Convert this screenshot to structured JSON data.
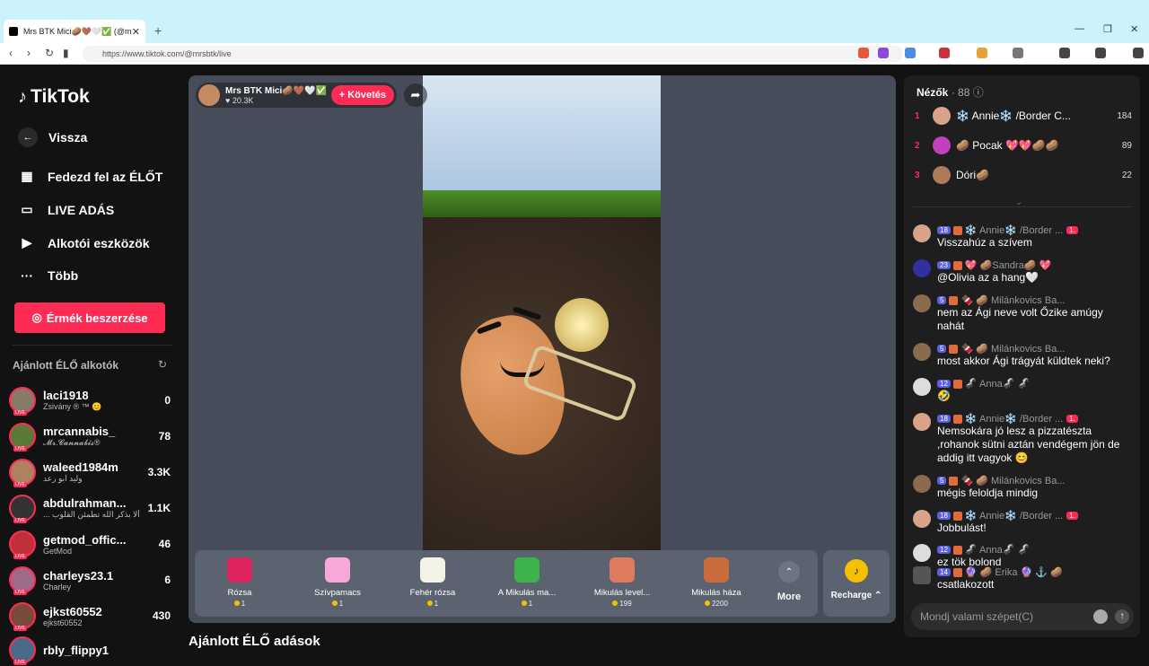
{
  "browser": {
    "tab_title": "Mrs BTK Mici🥔🤎🤍✅ (@m",
    "url": "https://www.tiktok.com/@mrsbtk/live"
  },
  "sidebar": {
    "logo": "TikTok",
    "back": "Vissza",
    "items": [
      {
        "label": "Fedezd fel az ÉLŐT",
        "icon": "calendar-icon"
      },
      {
        "label": "LIVE ADÁS",
        "icon": "camera-icon"
      },
      {
        "label": "Alkotói eszközök",
        "icon": "play-square-icon"
      },
      {
        "label": "Több",
        "icon": "more-dots-icon"
      }
    ],
    "coins_button": "Érmék beszerzése",
    "recommended_title": "Ajánlott ÉLŐ alkotók",
    "creators": [
      {
        "name": "laci1918",
        "sub": "Zsivány ® ™ 😊",
        "count": "0"
      },
      {
        "name": "mrcannabis_",
        "sub": "𝓜𝓻.𝓒𝓪𝓷𝓷𝓪𝓫𝓲𝓼®",
        "count": "78"
      },
      {
        "name": "waleed1984m",
        "sub": "وليد ابو رعد",
        "count": "3.3K"
      },
      {
        "name": "abdulrahman...",
        "sub": "... ألا بذكر الله تطمئن القلوب",
        "count": "1.1K"
      },
      {
        "name": "getmod_offic...",
        "sub": "GetMod",
        "count": "46"
      },
      {
        "name": "charleys23.1",
        "sub": "Charley",
        "count": "6"
      },
      {
        "name": "ejkst60552",
        "sub": "ejkst60552",
        "count": "430"
      },
      {
        "name": "rbly_flippy1",
        "sub": "",
        "count": ""
      }
    ],
    "live_badge": "LIVE"
  },
  "stream": {
    "streamer_name": "Mrs BTK Mici🥔🤎🤍✅",
    "likes": "♥ 20.3K",
    "follow": "+ Követés"
  },
  "gifts": [
    {
      "name": "Rózsa",
      "price": "1",
      "color": "#e0245e"
    },
    {
      "name": "Szívpamacs",
      "price": "1",
      "color": "#f7a8d8"
    },
    {
      "name": "Fehér rózsa",
      "price": "1",
      "color": "#f2f2e6"
    },
    {
      "name": "A Mikulás ma...",
      "price": "1",
      "color": "#3cb44b"
    },
    {
      "name": "Mikulás level...",
      "price": "199",
      "color": "#e07a5f"
    },
    {
      "name": "Mikulás háza",
      "price": "2200",
      "color": "#c96b3b"
    }
  ],
  "more_label": "More",
  "recharge_label": "Recharge ⌃",
  "bottom_title": "Ajánlott ÉLŐ adások",
  "viewers": {
    "title": "Nézők",
    "count": "· 88",
    "list": [
      {
        "rank": "1",
        "name": "❄️ Annie❄️ /Border C...",
        "score": "184",
        "color": "#d9a38a"
      },
      {
        "rank": "2",
        "name": "🥔 Pocak 💖💖🥔🥔",
        "score": "89",
        "color": "#c040c0"
      },
      {
        "rank": "3",
        "name": "Dóri🥔",
        "score": "22",
        "color": "#b07a5a"
      }
    ]
  },
  "chat": [
    {
      "level": "18",
      "user": "❄️ Annie❄️ /Border ...",
      "mod": "1.",
      "text": "Visszahúz a szívem",
      "color": "#d9a38a"
    },
    {
      "level": "23",
      "user": "💖 🥔Sandra🥔 💖",
      "mod": "",
      "text": "@Olivia az a hang🤍",
      "color": "#3030a0"
    },
    {
      "level": "5",
      "user": "🍫 🥔 Milánkovics Ba...",
      "mod": "",
      "text": "nem az Ági neve volt Őzike amúgy nahát",
      "color": "#8a6b4e"
    },
    {
      "level": "5",
      "user": "🍫 🥔 Milánkovics Ba...",
      "mod": "",
      "text": "most akkor Ági trágyát küldtek neki?",
      "color": "#8a6b4e"
    },
    {
      "level": "12",
      "user": "🦨 Anna🦨 🦨",
      "mod": "",
      "text": "🤣",
      "color": "#dddddd"
    },
    {
      "level": "18",
      "user": "❄️ Annie❄️ /Border ...",
      "mod": "1.",
      "text": "Nemsokára jó lesz a pizzatészta ,rohanok sütni aztán vendégem jön de addig itt vagyok 😊",
      "color": "#d9a38a"
    },
    {
      "level": "5",
      "user": "🍫 🥔 Milánkovics Ba...",
      "mod": "",
      "text": "mégis feloldja mindig",
      "color": "#8a6b4e"
    },
    {
      "level": "18",
      "user": "❄️ Annie❄️ /Border ...",
      "mod": "1.",
      "text": "Jobbulást!",
      "color": "#d9a38a"
    },
    {
      "level": "12",
      "user": "🦨 Anna🦨 🦨",
      "mod": "",
      "text": "ez tök bolond",
      "color": "#dddddd"
    },
    {
      "level": "14",
      "user": "🔮 🥔 Erika 🔮 ⚓ 🥔",
      "mod": "",
      "text": "csatlakozott",
      "color": "#555555"
    }
  ],
  "chat_placeholder": "Mondj valami szépet(C)"
}
